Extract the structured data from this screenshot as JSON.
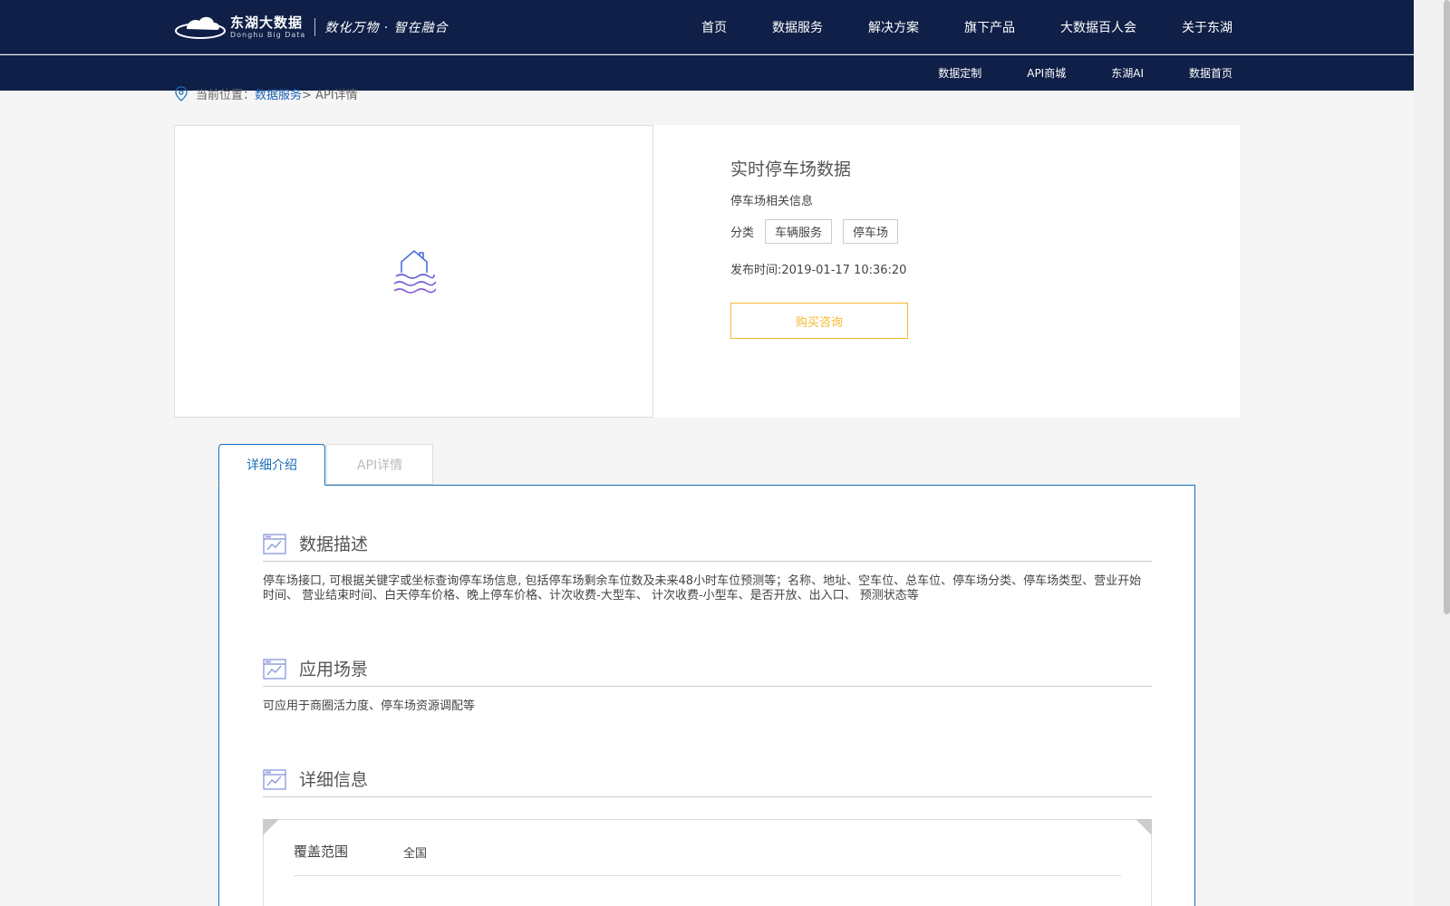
{
  "brand": {
    "name_cn": "东湖大数据",
    "name_en": "Donghu Big Data",
    "slogan": "数化万物 · 智在融合"
  },
  "main_nav": [
    "首页",
    "数据服务",
    "解决方案",
    "旗下产品",
    "大数据百人会",
    "关于东湖"
  ],
  "sub_nav": [
    "数据定制",
    "API商城",
    "东湖AI",
    "数据首页"
  ],
  "breadcrumb": {
    "prefix": "当前位置：",
    "link": "数据服务",
    "rest": " > API详情"
  },
  "product": {
    "title": "实时停车场数据",
    "subtitle": "停车场相关信息",
    "category_label": "分类",
    "tags": [
      "车辆服务",
      "停车场"
    ],
    "publish_time": "发布时间:2019-01-17 10:36:20",
    "buy_button": "购买咨询"
  },
  "tabs": [
    "详细介绍",
    "API详情"
  ],
  "sections": {
    "description": {
      "title": "数据描述",
      "body": "停车场接口, 可根据关键字或坐标查询停车场信息, 包括停车场剩余车位数及未来48小时车位预测等；名称、地址、空车位、总车位、停车场分类、停车场类型、营业开始时间、 营业结束时间、白天停车价格、晚上停车价格、计次收费-大型车、 计次收费-小型车、是否开放、出入口、 预测状态等"
    },
    "scenario": {
      "title": "应用场景",
      "body": "可应用于商圈活力度、停车场资源调配等"
    },
    "detail": {
      "title": "详细信息",
      "rows": [
        {
          "label": "覆盖范围",
          "value": "全国"
        }
      ]
    }
  },
  "colors": {
    "nav_bg": "#0f1f47",
    "accent": "#1a6fb8",
    "button": "#f5b731"
  }
}
